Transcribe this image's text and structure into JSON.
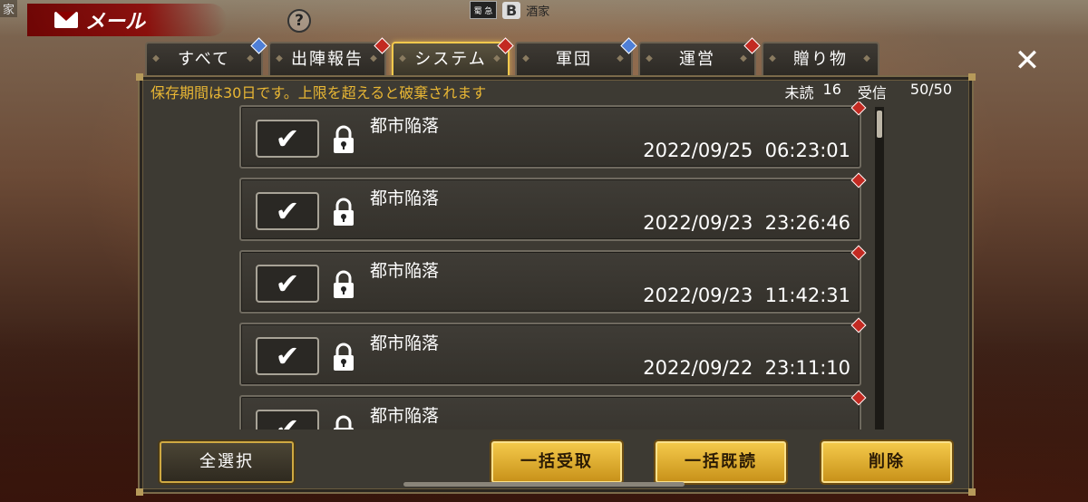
{
  "header": {
    "corner_text": "家",
    "title": "メール",
    "help": "?",
    "top_badge": "蜀 急",
    "top_grade": "B",
    "top_name": "酒家",
    "close": "✕"
  },
  "tabs": [
    {
      "label": "すべて",
      "badge": "blue",
      "active": false
    },
    {
      "label": "出陣報告",
      "badge": "red",
      "active": false
    },
    {
      "label": "システム",
      "badge": "red",
      "active": true
    },
    {
      "label": "軍団",
      "badge": "blue",
      "active": false
    },
    {
      "label": "運営",
      "badge": "red",
      "active": false
    },
    {
      "label": "贈り物",
      "badge": "none",
      "active": false
    }
  ],
  "notice": "保存期間は30日です。上限を超えると破棄されます",
  "counts": {
    "unread_label": "未読",
    "unread": "16",
    "received_label": "受信",
    "received": "50/50"
  },
  "mails": [
    {
      "subject": "都市陥落",
      "date": "2022/09/25  06:23:01",
      "checked": true,
      "locked": true
    },
    {
      "subject": "都市陥落",
      "date": "2022/09/23  23:26:46",
      "checked": true,
      "locked": true
    },
    {
      "subject": "都市陥落",
      "date": "2022/09/23  11:42:31",
      "checked": true,
      "locked": true
    },
    {
      "subject": "都市陥落",
      "date": "2022/09/22  23:11:10",
      "checked": true,
      "locked": true
    },
    {
      "subject": "都市陥落",
      "date": "",
      "checked": true,
      "locked": true
    }
  ],
  "buttons": {
    "select_all": "全選択",
    "bulk_receive": "一括受取",
    "bulk_read": "一括既読",
    "delete": "削除"
  },
  "colors": {
    "notice": "#e8b634",
    "badge_red": "#c32a22",
    "badge_blue": "#4f7fd6",
    "gold": "#f4c94a"
  }
}
